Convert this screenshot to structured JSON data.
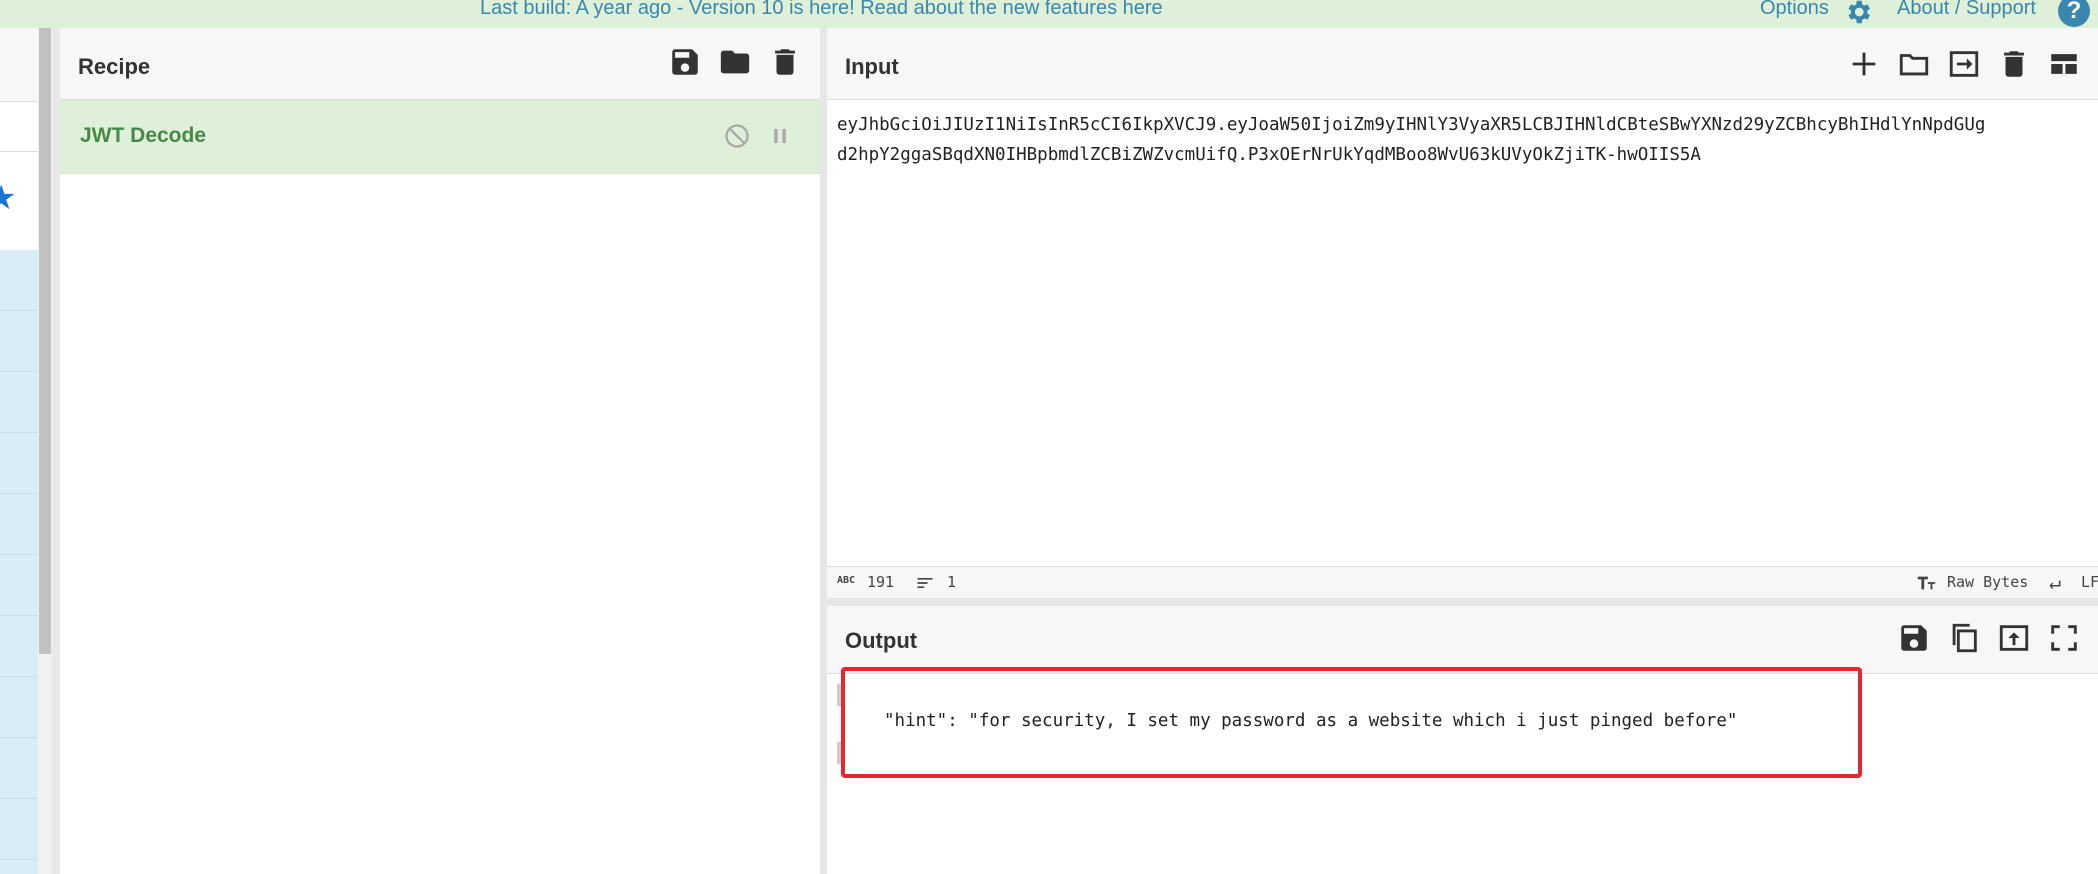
{
  "banner": {
    "message": "Last build: A year ago - Version 10 is here! Read about the new features here",
    "options_label": "Options",
    "about_label": "About / Support",
    "help_glyph": "?"
  },
  "recipe": {
    "title": "Recipe",
    "operations": [
      {
        "name": "JWT Decode"
      }
    ],
    "icons": [
      "save-icon",
      "folder-icon",
      "trash-icon"
    ]
  },
  "input": {
    "title": "Input",
    "line1": "eyJhbGciOiJIUzI1NiIsInR5cCI6IkpXVCJ9.eyJoaW50IjoiZm9yIHNlY3VyaXR5LCBJIHNldCBteSBwYXNzd29yZCBhcyBhIHdlYnNpdGUg",
    "line2": "d2hpY2ggaSBqdXN0IHBpbmdlZCBiZWZvcmUifQ.P3xOErNrUkYqdMBoo8WvU63kUVyOkZjiTK-hwOIIS5A",
    "char_count": "191",
    "line_count": "1",
    "encoding": "Raw Bytes",
    "eol": "LF",
    "abc_label": "ABC"
  },
  "output": {
    "title": "Output",
    "text": "\"hint\": \"for security, I set my password as a website which i just pinged before\""
  },
  "colors": {
    "banner_bg": "#dff0d8",
    "banner_text": "#3a87ad",
    "op_bg": "#dff0d8",
    "op_text": "#468847",
    "highlight": "#e8262d"
  }
}
